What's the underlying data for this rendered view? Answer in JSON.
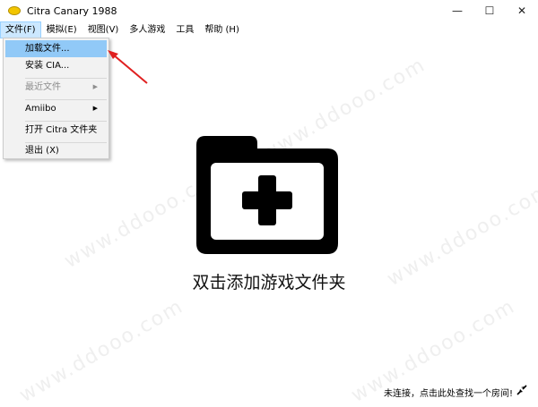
{
  "window": {
    "title": "Citra Canary 1988",
    "controls": {
      "minimize": "—",
      "maximize": "☐",
      "close": "✕"
    }
  },
  "menubar": {
    "items": [
      "文件(F)",
      "模拟(E)",
      "视图(V)",
      "多人游戏",
      "工具",
      "帮助 (H)"
    ]
  },
  "file_menu": {
    "items": [
      {
        "label": "加载文件...",
        "state": "highlighted"
      },
      {
        "label": "安装 CIA...",
        "state": "normal"
      },
      {
        "label": "最近文件",
        "state": "disabled",
        "submenu": true
      },
      {
        "label": "Amiibo",
        "state": "normal",
        "submenu": true
      },
      {
        "label": "打开 Citra 文件夹",
        "state": "normal"
      },
      {
        "label": "退出 (X)",
        "state": "normal"
      }
    ],
    "arrow_glyph": "▶"
  },
  "main": {
    "icon": "add-folder-icon",
    "hint": "双击添加游戏文件夹"
  },
  "statusbar": {
    "text": "未连接，点击此处查找一个房间!",
    "icon": "network-disconnected-icon"
  },
  "watermark": "www.ddooo.com",
  "colors": {
    "menu_highlight": "#91c9f7",
    "annotation_arrow": "#e02020",
    "app_icon": "#f2c500"
  }
}
